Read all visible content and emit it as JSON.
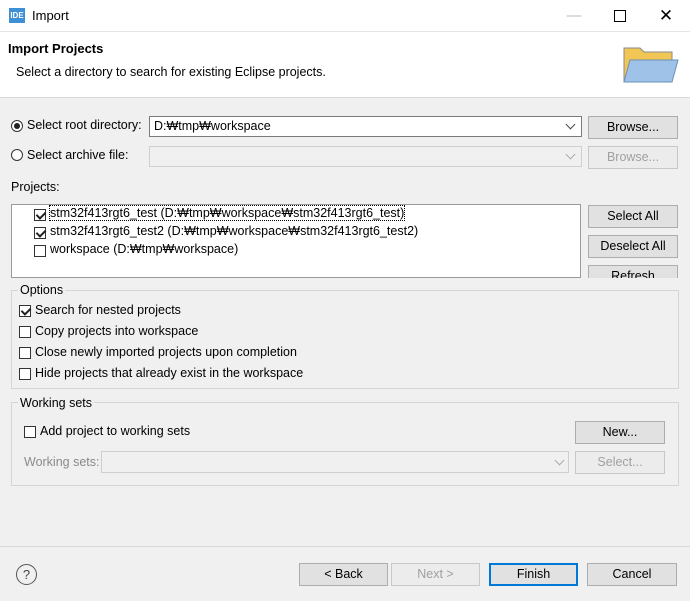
{
  "window": {
    "title": "Import",
    "app_icon_text": "IDE"
  },
  "header": {
    "title": "Import Projects",
    "description": "Select a directory to search for existing Eclipse projects."
  },
  "root_dir": {
    "label": "Select root directory:",
    "value": "D:₩tmp₩workspace",
    "browse": "Browse..."
  },
  "archive": {
    "label": "Select archive file:",
    "value": "",
    "browse": "Browse..."
  },
  "projects": {
    "label": "Projects:",
    "items": [
      {
        "label": "stm32f413rgt6_test (D:₩tmp₩workspace₩stm32f413rgt6_test)",
        "checked": true
      },
      {
        "label": "stm32f413rgt6_test2 (D:₩tmp₩workspace₩stm32f413rgt6_test2)",
        "checked": true
      },
      {
        "label": "workspace (D:₩tmp₩workspace)",
        "checked": false
      }
    ],
    "select_all": "Select All",
    "deselect_all": "Deselect All",
    "refresh": "Refresh"
  },
  "options": {
    "title": "Options",
    "items": [
      {
        "label": "Search for nested projects",
        "checked": true
      },
      {
        "label": "Copy projects into workspace",
        "checked": false
      },
      {
        "label": "Close newly imported projects upon completion",
        "checked": false
      },
      {
        "label": "Hide projects that already exist in the workspace",
        "checked": false
      }
    ]
  },
  "working_sets": {
    "title": "Working sets",
    "add_label": "Add project to working sets",
    "new_button": "New...",
    "sets_label": "Working sets:",
    "select_button": "Select..."
  },
  "footer": {
    "help": "?",
    "back": "< Back",
    "next": "Next >",
    "finish": "Finish",
    "cancel": "Cancel"
  }
}
